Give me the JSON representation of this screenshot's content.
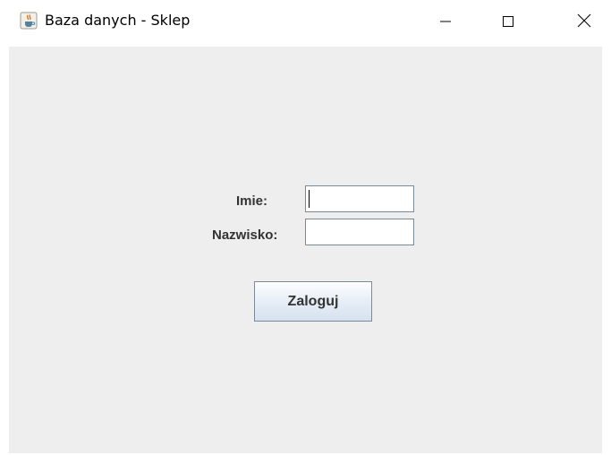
{
  "window": {
    "title": "Baza danych - Sklep",
    "icon": "java-cup-icon",
    "controls": {
      "minimize": "—",
      "maximize": "☐",
      "close": "✕"
    }
  },
  "form": {
    "imie_label": "Imie:",
    "imie_value": "",
    "nazwisko_label": "Nazwisko:",
    "nazwisko_value": "",
    "login_label": "Zaloguj"
  },
  "colors": {
    "panel_bg": "#eeeeee",
    "field_border": "#7a8a99",
    "label_text": "#333333"
  }
}
